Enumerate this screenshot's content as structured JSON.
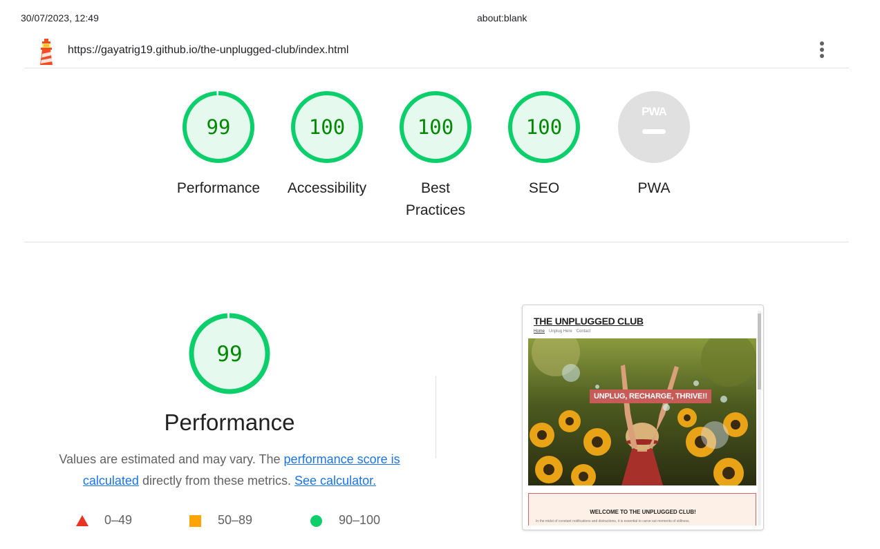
{
  "print_header": {
    "datetime": "30/07/2023, 12:49",
    "page_title": "about:blank"
  },
  "topbar": {
    "url": "https://gayatrig19.github.io/the-unplugged-club/index.html",
    "logo_icon": "lighthouse-icon",
    "menu_icon": "kebab-menu-icon"
  },
  "categories": [
    {
      "score": "99",
      "label": "Performance",
      "fraction": 0.99
    },
    {
      "score": "100",
      "label": "Accessibility",
      "fraction": 1.0
    },
    {
      "score": "100",
      "label": "Best Practices",
      "fraction": 1.0
    },
    {
      "score": "100",
      "label": "SEO",
      "fraction": 1.0
    },
    {
      "score": "PWA",
      "label": "PWA",
      "fraction": null
    }
  ],
  "performance": {
    "score": "99",
    "fraction": 0.99,
    "title": "Performance",
    "desc_prefix": "Values are estimated and may vary. The ",
    "link_score": "performance score is calculated",
    "desc_middle": " directly from these metrics. ",
    "link_calculator": "See calculator."
  },
  "legend": [
    {
      "range": "0–49",
      "shape": "triangle",
      "color": "#eb3323"
    },
    {
      "range": "50–89",
      "shape": "square",
      "color": "#ffa400"
    },
    {
      "range": "90–100",
      "shape": "circle",
      "color": "#0cce6b"
    }
  ],
  "screenshot": {
    "site_title": "THE UNPLUGGED CLUB",
    "nav": [
      "Home",
      "Unplug Here",
      "Contact"
    ],
    "hero_banner": "UNPLUG, RECHARGE, THRIVE!!",
    "welcome_title": "WELCOME TO THE UNPLUGGED CLUB!",
    "welcome_text": "In the midst of constant notifications and distractions, it is essential to carve out moments of stillness."
  },
  "colors": {
    "pass": "#0cce6b",
    "pass_fill": "#e5f9ee",
    "pass_text": "#008800",
    "link": "#1a73e8",
    "pwa_gray": "#e0e0e0"
  }
}
